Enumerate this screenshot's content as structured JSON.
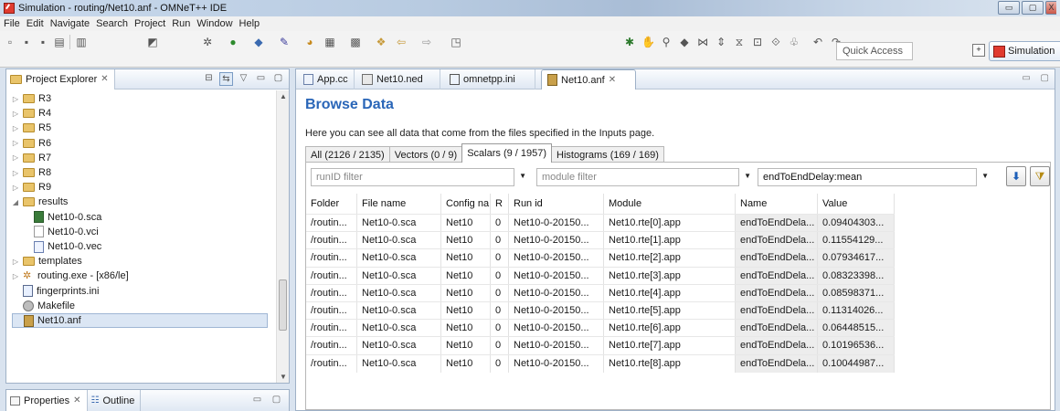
{
  "window": {
    "title": "Simulation - routing/Net10.anf - OMNeT++ IDE",
    "btn_minimize": "▭",
    "btn_maximize": "▢",
    "btn_close": "X"
  },
  "menu": [
    "File",
    "Edit",
    "Navigate",
    "Search",
    "Project",
    "Run",
    "Window",
    "Help"
  ],
  "toolbar": {
    "quick_access_placeholder": "Quick Access",
    "perspective_label": "Simulation"
  },
  "project_explorer": {
    "title": "Project Explorer",
    "tree": [
      {
        "label": "R3",
        "type": "folder",
        "expanded": false
      },
      {
        "label": "R4",
        "type": "folder",
        "expanded": false
      },
      {
        "label": "R5",
        "type": "folder",
        "expanded": false
      },
      {
        "label": "R6",
        "type": "folder",
        "expanded": false
      },
      {
        "label": "R7",
        "type": "folder",
        "expanded": false
      },
      {
        "label": "R8",
        "type": "folder",
        "expanded": false
      },
      {
        "label": "R9",
        "type": "folder",
        "expanded": false
      },
      {
        "label": "results",
        "type": "folder",
        "expanded": true
      },
      {
        "label": "Net10-0.sca",
        "type": "sca",
        "level": 2
      },
      {
        "label": "Net10-0.vci",
        "type": "file",
        "level": 2
      },
      {
        "label": "Net10-0.vec",
        "type": "vec",
        "level": 2
      },
      {
        "label": "templates",
        "type": "folder",
        "expanded": false
      },
      {
        "label": "routing.exe - [x86/le]",
        "type": "exe",
        "expanded": false
      },
      {
        "label": "fingerprints.ini",
        "type": "ini"
      },
      {
        "label": "Makefile",
        "type": "make"
      },
      {
        "label": "Net10.anf",
        "type": "anf",
        "selected": true
      }
    ]
  },
  "bottom_views": {
    "properties": "Properties",
    "outline": "Outline"
  },
  "editor": {
    "tabs": [
      {
        "label": "App.cc",
        "icon": "cpp-file-icon"
      },
      {
        "label": "Net10.ned",
        "icon": "ned-file-icon"
      },
      {
        "label": "omnetpp.ini",
        "icon": "ini-file-icon"
      },
      {
        "label": "Net10.anf",
        "icon": "anf-file-icon",
        "active": true
      }
    ],
    "heading": "Browse Data",
    "description": "Here you can see all data that come from the files specified in the Inputs page.",
    "data_tabs": [
      {
        "label": "All (2126 / 2135)"
      },
      {
        "label": "Vectors (0 / 9)"
      },
      {
        "label": "Scalars (9 / 1957)",
        "active": true
      },
      {
        "label": "Histograms (169 / 169)"
      }
    ],
    "filters": {
      "run": "runID filter",
      "module": "module filter",
      "name": "endToEndDelay:mean"
    },
    "columns": [
      "Folder",
      "File name",
      "Config na...",
      "R",
      "Run id",
      "Module",
      "Name",
      "Value"
    ],
    "rows": [
      [
        "/routin...",
        "Net10-0.sca",
        "Net10",
        "0",
        "Net10-0-20150...",
        "Net10.rte[0].app",
        "endToEndDela...",
        "0.09404303..."
      ],
      [
        "/routin...",
        "Net10-0.sca",
        "Net10",
        "0",
        "Net10-0-20150...",
        "Net10.rte[1].app",
        "endToEndDela...",
        "0.11554129..."
      ],
      [
        "/routin...",
        "Net10-0.sca",
        "Net10",
        "0",
        "Net10-0-20150...",
        "Net10.rte[2].app",
        "endToEndDela...",
        "0.07934617..."
      ],
      [
        "/routin...",
        "Net10-0.sca",
        "Net10",
        "0",
        "Net10-0-20150...",
        "Net10.rte[3].app",
        "endToEndDela...",
        "0.08323398..."
      ],
      [
        "/routin...",
        "Net10-0.sca",
        "Net10",
        "0",
        "Net10-0-20150...",
        "Net10.rte[4].app",
        "endToEndDela...",
        "0.08598371..."
      ],
      [
        "/routin...",
        "Net10-0.sca",
        "Net10",
        "0",
        "Net10-0-20150...",
        "Net10.rte[5].app",
        "endToEndDela...",
        "0.11314026..."
      ],
      [
        "/routin...",
        "Net10-0.sca",
        "Net10",
        "0",
        "Net10-0-20150...",
        "Net10.rte[6].app",
        "endToEndDela...",
        "0.06448515..."
      ],
      [
        "/routin...",
        "Net10-0.sca",
        "Net10",
        "0",
        "Net10-0-20150...",
        "Net10.rte[7].app",
        "endToEndDela...",
        "0.10196536..."
      ],
      [
        "/routin...",
        "Net10-0.sca",
        "Net10",
        "0",
        "Net10-0-20150...",
        "Net10.rte[8].app",
        "endToEndDela...",
        "0.10044987..."
      ]
    ]
  }
}
